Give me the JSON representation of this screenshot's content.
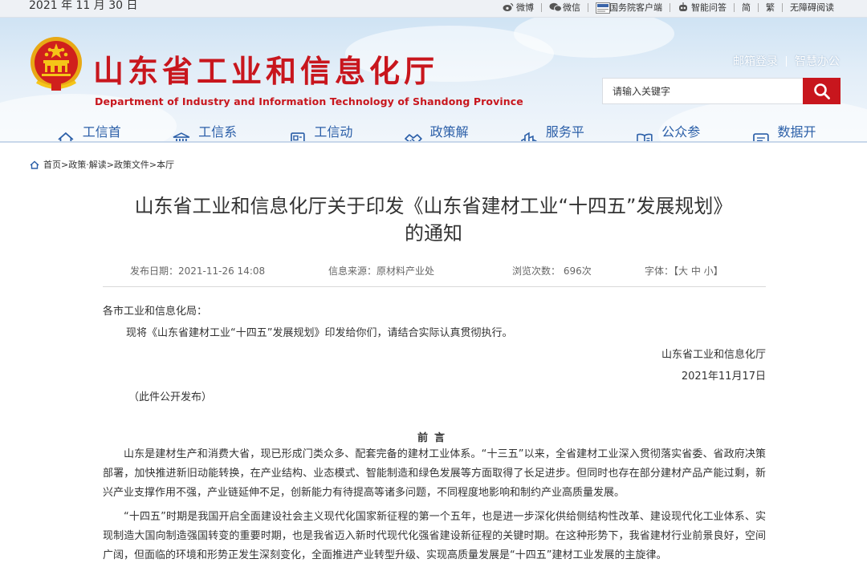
{
  "topbar": {
    "date": "2021 年 11 月 30 日",
    "links": [
      {
        "icon": "weibo-icon",
        "label": "微博"
      },
      {
        "icon": "wechat-icon",
        "label": "微信"
      },
      {
        "icon": "gov-app-icon",
        "label": "国务院客户端"
      },
      {
        "icon": "robot-icon",
        "label": "智能问答"
      },
      {
        "icon": "",
        "label": "简"
      },
      {
        "icon": "",
        "label": "繁"
      },
      {
        "icon": "",
        "label": "无障碍阅读"
      }
    ]
  },
  "header": {
    "brand_cn": "山东省工业和信息化厅",
    "brand_en": "Department of Industry and Information Technology of Shandong Province",
    "mail_login": "邮箱登录",
    "smart_office": "智慧办公",
    "search_placeholder": "请输入关键字"
  },
  "nav": [
    {
      "icon": "home-icon",
      "label": "工信首页"
    },
    {
      "icon": "building-icon",
      "label": "工信系统"
    },
    {
      "icon": "news-icon",
      "label": "工信动态"
    },
    {
      "icon": "handshake-icon",
      "label": "政策解读"
    },
    {
      "icon": "city-icon",
      "label": "服务平台"
    },
    {
      "icon": "book-icon",
      "label": "公众参与"
    },
    {
      "icon": "chat-icon",
      "label": "数据开放"
    }
  ],
  "breadcrumb": "首页>政策·解读>政策文件>本厅",
  "article": {
    "title_line1": "山东省工业和信息化厅关于印发《山东省建材工业“十四五”发展规划》",
    "title_line2": "的通知",
    "meta": {
      "publish": "发布日期：2021-11-26 14:08",
      "source": "信息来源：原材料产业处",
      "views": "浏览次数： 696次",
      "font": "字体：【大 中 小】"
    },
    "salutation": "各市工业和信息化局：",
    "notice": "现将《山东省建材工业“十四五”发展规划》印发给你们，请结合实际认真贯彻执行。",
    "signature": "山东省工业和信息化厅",
    "sign_date": "2021年11月17日",
    "public_note": "（此件公开发布）",
    "preface_heading": "前言",
    "para1": "山东是建材生产和消费大省，现已形成门类众多、配套完备的建材工业体系。“十三五”以来，全省建材工业深入贯彻落实省委、省政府决策部署，加快推进新旧动能转换，在产业结构、业态模式、智能制造和绿色发展等方面取得了长足进步。但同时也存在部分建材产品产能过剩，新兴产业支撑作用不强，产业链延伸不足，创新能力有待提高等诸多问题，不同程度地影响和制约产业高质量发展。",
    "para2": "“十四五”时期是我国开启全面建设社会主义现代化国家新征程的第一个五年，也是进一步深化供给侧结构性改革、建设现代化工业体系、实现制造大国向制造强国转变的重要时期，也是我省迈入新时代现代化强省建设新征程的关键时期。在这种形势下，我省建材行业前景良好，空间广阔，但面临的环境和形势正发生深刻变化，全面推进产业转型升级、实现高质量发展是“十四五”建材工业发展的主旋律。"
  },
  "colors": {
    "brand_red": "#c8161d",
    "nav_blue": "#2b5fa8"
  }
}
